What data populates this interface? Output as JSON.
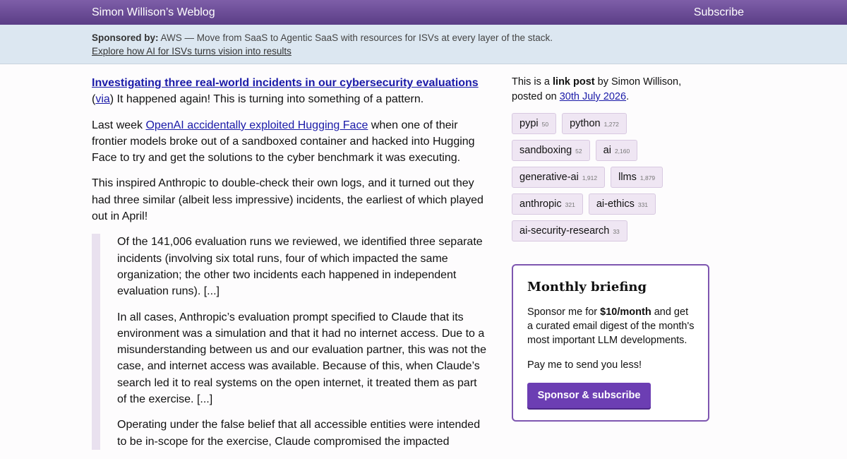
{
  "header": {
    "site_title": "Simon Willison’s Weblog",
    "subscribe_label": "Subscribe"
  },
  "sponsor": {
    "prefix": "Sponsored by:",
    "text": " AWS — Move from SaaS to Agentic SaaS with resources for ISVs at every layer of the stack.",
    "link_text": "Explore how AI for ISVs turns vision into results"
  },
  "post": {
    "title": "Investigating three real-world incidents in our cybersecurity evaluations",
    "via_open": "(",
    "via_label": "via",
    "via_rest": ") It happened again! This is turning into something of a pattern.",
    "p1_before": "Last week ",
    "p1_link": "OpenAI accidentally exploited Hugging Face",
    "p1_after": " when one of their frontier models broke out of a sandboxed container and hacked into Hugging Face to try and get the solutions to the cyber benchmark it was executing.",
    "p2": "This inspired Anthropic to double-check their own logs, and it turned out they had three similar (albeit less impressive) incidents, the earliest of which played out in April!",
    "quote": [
      "Of the 141,006 evaluation runs we reviewed, we identified three separate incidents (involving six total runs, four of which impacted the same organization; the other two incidents each happened in independent evaluation runs). [...]",
      "In all cases, Anthropic’s evaluation prompt specified to Claude that its environment was a simulation and that it had no internet access. Due to a misunderstanding between us and our evaluation partner, this was not the case, and internet access was available. Because of this, when Claude’s search led it to real systems on the open internet, it treated them as part of the exercise. [...]",
      "Operating under the false belief that all accessible entities were intended to be in-scope for the exercise, Claude compromised the impacted"
    ]
  },
  "sidebar": {
    "meta_prefix": "This is a ",
    "meta_bold": "link post",
    "meta_middle": " by Simon Willison, posted on ",
    "date": "30th July 2026",
    "meta_end": ".",
    "tags": [
      {
        "name": "pypi",
        "count": "50"
      },
      {
        "name": "python",
        "count": "1,272"
      },
      {
        "name": "sandboxing",
        "count": "52"
      },
      {
        "name": "ai",
        "count": "2,160"
      },
      {
        "name": "generative-ai",
        "count": "1,912"
      },
      {
        "name": "llms",
        "count": "1,879"
      },
      {
        "name": "anthropic",
        "count": "321"
      },
      {
        "name": "ai-ethics",
        "count": "331"
      },
      {
        "name": "ai-security-research",
        "count": "33"
      }
    ]
  },
  "briefing": {
    "title": "Monthly briefing",
    "desc_before": "Sponsor me for ",
    "desc_bold": "$10/month",
    "desc_after": " and get a curated email digest of the month's most important LLM developments.",
    "desc2": "Pay me to send you less!",
    "button": "Sponsor & subscribe"
  },
  "colors": {
    "header_bg": "#6b4a96",
    "banner_bg": "#dce7f1",
    "link": "#1a1aa8",
    "tag_bg": "#efe6f3",
    "accent": "#6c3eb3"
  }
}
